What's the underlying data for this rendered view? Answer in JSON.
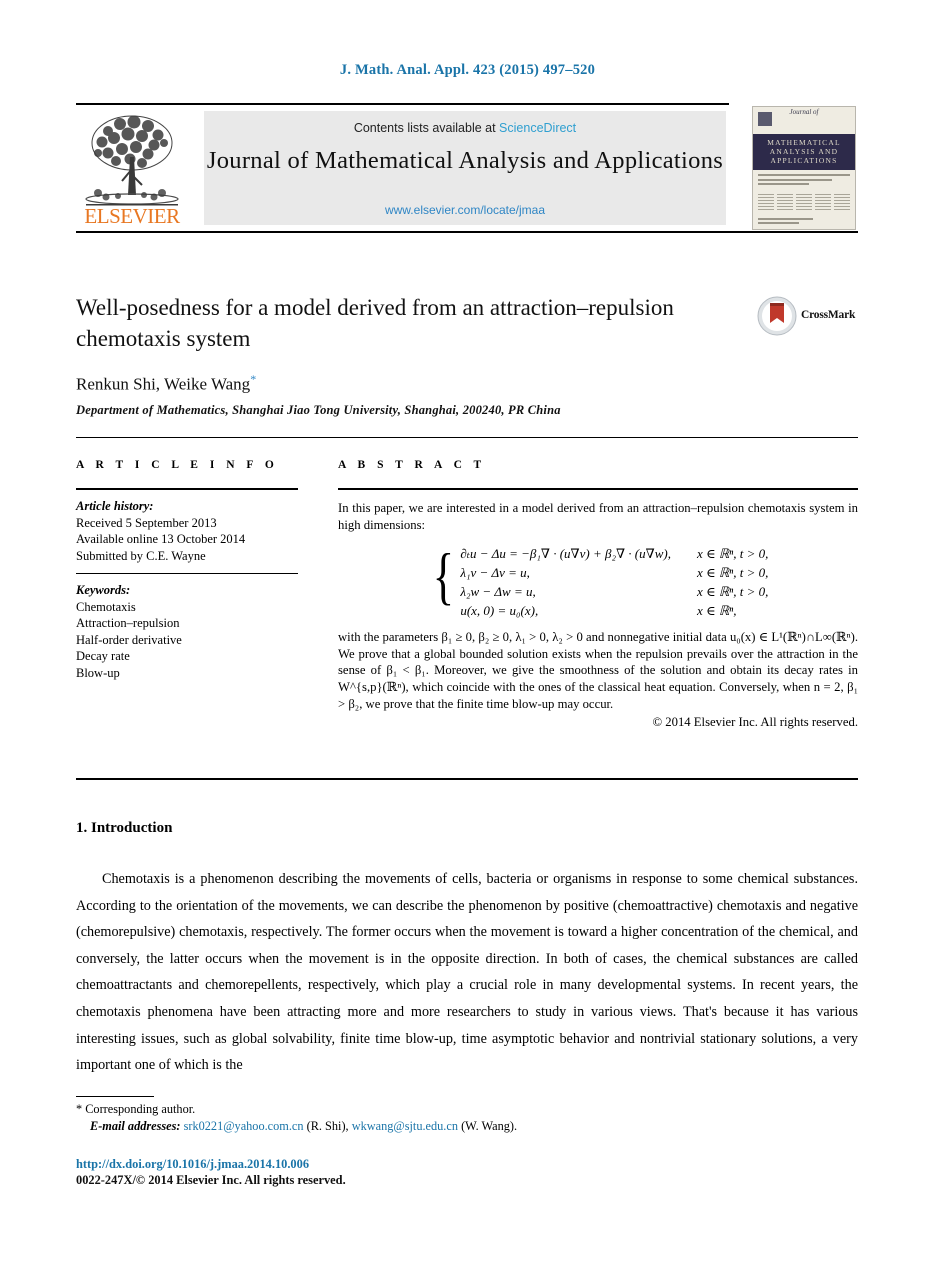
{
  "running_head": "J. Math. Anal. Appl. 423 (2015) 497–520",
  "masthead": {
    "contents_text": "Contents lists available at ",
    "sciencedirect": "ScienceDirect",
    "journal_name": "Journal of Mathematical Analysis and Applications",
    "journal_url": "www.elsevier.com/locate/jmaa",
    "publisher": "ELSEVIER",
    "cover": {
      "journal_of": "Journal of",
      "line1": "MATHEMATICAL",
      "line2": "ANALYSIS AND",
      "line3": "APPLICATIONS"
    }
  },
  "article": {
    "title": "Well-posedness for a model derived from an attraction–repulsion chemotaxis system",
    "authors": "Renkun Shi, Weike Wang",
    "corresponding_marker": "*",
    "affiliation": "Department of Mathematics, Shanghai Jiao Tong University, Shanghai, 200240, PR China",
    "crossmark_label": "CrossMark"
  },
  "info": {
    "heading": "A R T I C L E   I N F O",
    "history_label": "Article history:",
    "history": [
      "Received 5 September 2013",
      "Available online 13 October 2014",
      "Submitted by C.E. Wayne"
    ],
    "keywords_label": "Keywords:",
    "keywords": [
      "Chemotaxis",
      "Attraction–repulsion",
      "Half-order derivative",
      "Decay rate",
      "Blow-up"
    ]
  },
  "abstract": {
    "heading": "A B S T R A C T",
    "intro": "In this paper, we are interested in a model derived from an attraction–repulsion chemotaxis system in high dimensions:",
    "equations": [
      {
        "lhs": "∂ₜu − Δu = −β₁∇ · (u∇v) + β₂∇ · (u∇w),",
        "rhs": "x ∈ ℝⁿ, t > 0,"
      },
      {
        "lhs": "λ₁v − Δv = u,",
        "rhs": "x ∈ ℝⁿ, t > 0,"
      },
      {
        "lhs": "λ₂w − Δw = u,",
        "rhs": "x ∈ ℝⁿ, t > 0,"
      },
      {
        "lhs": "u(x, 0) = u₀(x),",
        "rhs": "x ∈ ℝⁿ,"
      }
    ],
    "body": "with the parameters β₁ ≥ 0, β₂ ≥ 0, λ₁ > 0, λ₂ > 0 and nonnegative initial data u₀(x) ∈ L¹(ℝⁿ)∩L∞(ℝⁿ). We prove that a global bounded solution exists when the repulsion prevails over the attraction in the sense of β₁ < β₁. Moreover, we give the smoothness of the solution and obtain its decay rates in W^{s,p}(ℝⁿ), which coincide with the ones of the classical heat equation. Conversely, when n = 2, β₁ > β₂, we prove that the finite time blow-up may occur.",
    "copyright": "© 2014 Elsevier Inc. All rights reserved."
  },
  "section": {
    "number_title": "1.  Introduction",
    "paragraph": "Chemotaxis is a phenomenon describing the movements of cells, bacteria or organisms in response to some chemical substances. According to the orientation of the movements, we can describe the phenomenon by positive (chemoattractive) chemotaxis and negative (chemorepulsive) chemotaxis, respectively. The former occurs when the movement is toward a higher concentration of the chemical, and conversely, the latter occurs when the movement is in the opposite direction. In both of cases, the chemical substances are called chemoattractants and chemorepellents, respectively, which play a crucial role in many developmental systems. In recent years, the chemotaxis phenomena have been attracting more and more researchers to study in various views. That's because it has various interesting issues, such as global solvability, finite time blow-up, time asymptotic behavior and nontrivial stationary solutions, a very important one of which is the"
  },
  "footer": {
    "corresponding": "Corresponding author.",
    "email_label": "E-mail addresses:",
    "email1": "srk0221@yahoo.com.cn",
    "email1_owner": "(R. Shi),",
    "email2": "wkwang@sjtu.edu.cn",
    "email2_owner": "(W. Wang).",
    "doi": "http://dx.doi.org/10.1016/j.jmaa.2014.10.006",
    "issn_line": "0022-247X/© 2014 Elsevier Inc. All rights reserved."
  }
}
